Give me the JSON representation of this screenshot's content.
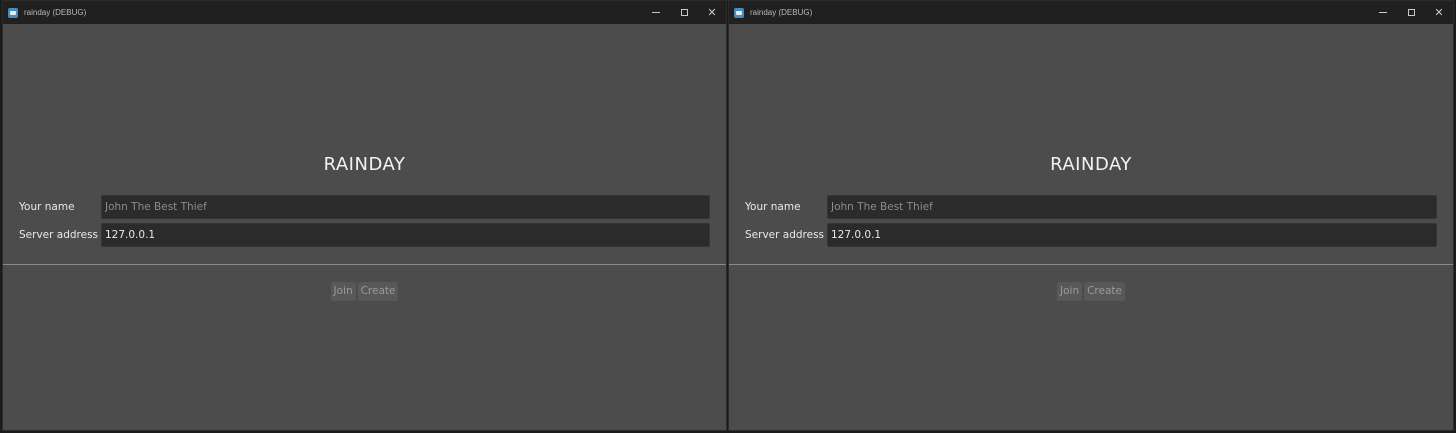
{
  "windows": [
    {
      "title": "rainday (DEBUG)",
      "game_title": "RAINDAY",
      "name_label": "Your name",
      "name_placeholder": "John The Best Thief",
      "name_value": "",
      "address_label": "Server address",
      "address_value": "127.0.0.1",
      "join_label": "Join",
      "create_label": "Create"
    },
    {
      "title": "rainday (DEBUG)",
      "game_title": "RAINDAY",
      "name_label": "Your name",
      "name_placeholder": "John The Best Thief",
      "name_value": "",
      "address_label": "Server address",
      "address_value": "127.0.0.1",
      "join_label": "Join",
      "create_label": "Create"
    }
  ],
  "window_controls": {
    "minimize": "minimize-icon",
    "maximize": "maximize-icon",
    "close": "close-icon"
  },
  "colors": {
    "window_bg": "#4c4c4c",
    "titlebar_bg": "#202020",
    "input_bg": "#2b2b2b",
    "button_bg": "#585858"
  }
}
